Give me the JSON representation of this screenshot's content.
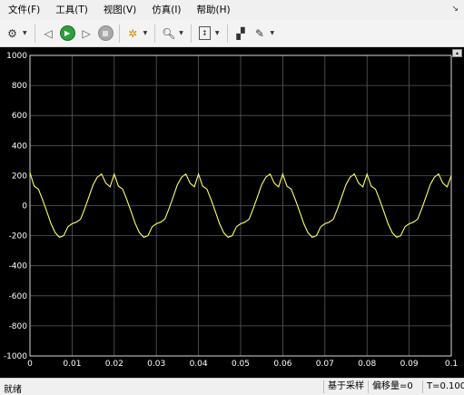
{
  "menu": {
    "items": [
      "文件(F)",
      "工具(T)",
      "视图(V)",
      "仿真(I)",
      "帮助(H)"
    ],
    "overflow_icon": "corner-arrow-icon"
  },
  "toolbar": {
    "buttons": [
      {
        "name": "settings-button",
        "icon": "gear-icon"
      },
      {
        "name": "step-back-button",
        "icon": "step-back-icon"
      },
      {
        "name": "run-button",
        "icon": "play-icon"
      },
      {
        "name": "step-forward-button",
        "icon": "step-forward-icon"
      },
      {
        "name": "stop-button",
        "icon": "stop-icon"
      },
      {
        "name": "highlight-button",
        "icon": "highlight-icon"
      },
      {
        "name": "zoom-button",
        "icon": "zoom-icon"
      },
      {
        "name": "autoscale-button",
        "icon": "autoscale-icon"
      },
      {
        "name": "style-button",
        "icon": "style-icon"
      },
      {
        "name": "edit-button",
        "icon": "pencil-icon"
      }
    ]
  },
  "chart_data": {
    "type": "line",
    "grid": true,
    "background": "#000000",
    "axis_color": "#ffffff",
    "series_color": "#ffff66",
    "xlim": [
      0,
      0.1
    ],
    "ylim": [
      -1000,
      1000
    ],
    "xticks": [
      0,
      0.01,
      0.02,
      0.03,
      0.04,
      0.05,
      0.06,
      0.07,
      0.08,
      0.09,
      0.1
    ],
    "xtick_labels": [
      "0",
      "0.01",
      "0.02",
      "0.03",
      "0.04",
      "0.05",
      "0.06",
      "0.07",
      "0.08",
      "0.09",
      "0.1"
    ],
    "yticks": [
      -1000,
      -800,
      -600,
      -400,
      -200,
      0,
      200,
      400,
      600,
      800,
      1000
    ],
    "ytick_labels": [
      "-1000",
      "-800",
      "-600",
      "-400",
      "-200",
      "0",
      "200",
      "400",
      "600",
      "800",
      "1000"
    ],
    "series": [
      {
        "x": [
          0,
          0.001,
          0.002,
          0.003,
          0.004,
          0.005,
          0.006,
          0.007,
          0.008,
          0.009,
          0.01,
          0.011,
          0.012,
          0.013,
          0.014,
          0.015,
          0.016,
          0.017,
          0.018,
          0.019,
          0.02,
          0.021,
          0.022,
          0.023,
          0.024,
          0.025,
          0.026,
          0.027,
          0.028,
          0.029,
          0.03,
          0.031,
          0.032,
          0.033,
          0.034,
          0.035,
          0.036,
          0.037,
          0.038,
          0.039,
          0.04,
          0.041,
          0.042,
          0.043,
          0.044,
          0.045,
          0.046,
          0.047,
          0.048,
          0.049,
          0.05,
          0.051,
          0.052,
          0.053,
          0.054,
          0.055,
          0.056,
          0.057,
          0.058,
          0.059,
          0.06,
          0.061,
          0.062,
          0.063,
          0.064,
          0.065,
          0.066,
          0.067,
          0.068,
          0.069,
          0.07,
          0.071,
          0.072,
          0.073,
          0.074,
          0.075,
          0.076,
          0.077,
          0.078,
          0.079,
          0.08,
          0.081,
          0.082,
          0.083,
          0.084,
          0.085,
          0.086,
          0.087,
          0.088,
          0.089,
          0.09,
          0.091,
          0.092,
          0.093,
          0.094,
          0.095,
          0.096,
          0.097,
          0.098,
          0.099,
          0.1
        ],
        "y": [
          220,
          130,
          110,
          40,
          -40,
          -120,
          -180,
          -210,
          -200,
          -140,
          -120,
          -110,
          -90,
          -20,
          60,
          140,
          190,
          210,
          150,
          125,
          210,
          130,
          110,
          40,
          -40,
          -120,
          -180,
          -210,
          -200,
          -140,
          -120,
          -110,
          -90,
          -20,
          60,
          140,
          190,
          210,
          150,
          125,
          210,
          130,
          110,
          40,
          -40,
          -120,
          -180,
          -210,
          -200,
          -140,
          -120,
          -110,
          -90,
          -20,
          60,
          140,
          190,
          210,
          150,
          125,
          210,
          130,
          110,
          40,
          -40,
          -120,
          -180,
          -210,
          -200,
          -140,
          -120,
          -110,
          -90,
          -20,
          60,
          140,
          190,
          210,
          150,
          125,
          210,
          130,
          110,
          40,
          -40,
          -120,
          -180,
          -210,
          -200,
          -140,
          -120,
          -110,
          -90,
          -20,
          60,
          140,
          190,
          210,
          150,
          125,
          200
        ]
      }
    ]
  },
  "status": {
    "left": "就绪",
    "sample_mode": "基于采样",
    "offset": "偏移量=0",
    "time": "T=0.100"
  }
}
